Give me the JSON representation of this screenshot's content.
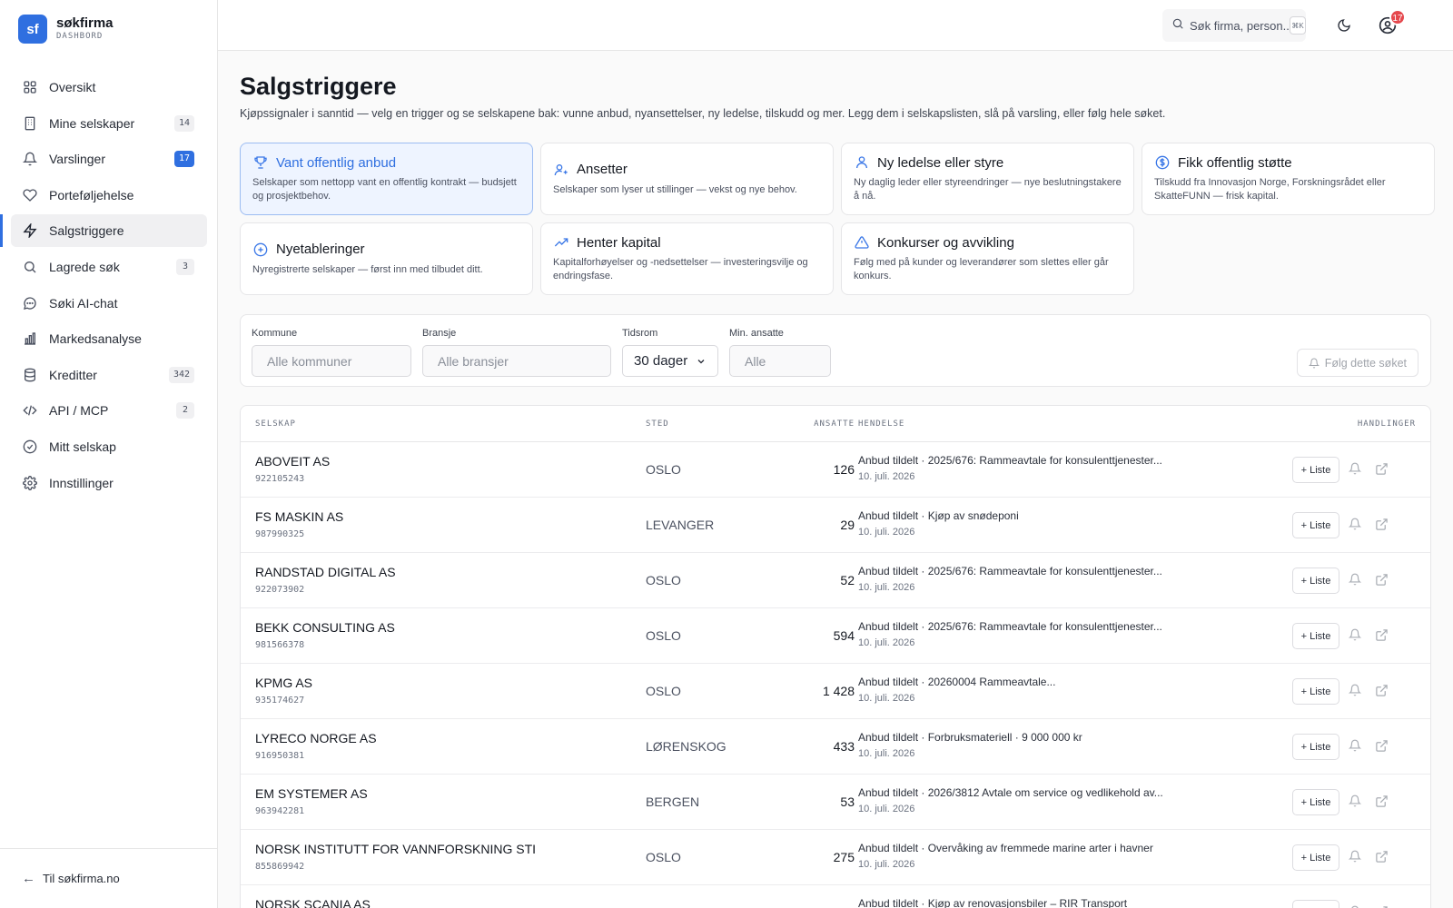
{
  "brand": {
    "logo": "sf",
    "name": "søkfirma",
    "subtitle": "DASHBORD"
  },
  "nav": [
    {
      "label": "Oversikt",
      "icon": "grid-icon",
      "badge": ""
    },
    {
      "label": "Mine selskaper",
      "icon": "building-icon",
      "badge": "14"
    },
    {
      "label": "Varslinger",
      "icon": "bell-icon",
      "badge": "17",
      "badge_style": "blue"
    },
    {
      "label": "Porteføljehelse",
      "icon": "heart-icon",
      "badge": ""
    },
    {
      "label": "Salgstriggere",
      "icon": "bolt-icon",
      "badge": "",
      "active": true
    },
    {
      "label": "Lagrede søk",
      "icon": "search-icon",
      "badge": "3"
    },
    {
      "label": "Søki AI-chat",
      "icon": "chat-icon",
      "badge": ""
    },
    {
      "label": "Markedsanalyse",
      "icon": "bar-chart-icon",
      "badge": ""
    },
    {
      "label": "Kreditter",
      "icon": "database-icon",
      "badge": "342"
    },
    {
      "label": "API / MCP",
      "icon": "code-icon",
      "badge": "2"
    },
    {
      "label": "Mitt selskap",
      "icon": "check-circle-icon",
      "badge": ""
    },
    {
      "label": "Innstillinger",
      "icon": "gear-icon",
      "badge": ""
    }
  ],
  "footer_link": "Til søkfirma.no",
  "topbar": {
    "search_placeholder": "Søk firma, person...",
    "shortcut": "⌘K",
    "notification_count": "17"
  },
  "page": {
    "title": "Salgstriggere",
    "subtitle": "Kjøpssignaler i sanntid — velg en trigger og se selskapene bak: vunne anbud, nyansettelser, ny ledelse, tilskudd og mer. Legg dem i selskapslisten, slå på varsling, eller følg hele søket."
  },
  "triggers": [
    {
      "title": "Vant offentlig anbud",
      "desc": "Selskaper som nettopp vant en offentlig kontrakt — budsjett og prosjektbehov.",
      "icon": "trophy-icon",
      "active": true
    },
    {
      "title": "Ansetter",
      "desc": "Selskaper som lyser ut stillinger — vekst og nye behov.",
      "icon": "user-plus-icon"
    },
    {
      "title": "Ny ledelse eller styre",
      "desc": "Ny daglig leder eller styreendringer — nye beslutningstakere å nå.",
      "icon": "user-icon"
    },
    {
      "title": "Fikk offentlig støtte",
      "desc": "Tilskudd fra Innovasjon Norge, Forskningsrådet eller SkatteFUNN — frisk kapital.",
      "icon": "dollar-circle-icon"
    },
    {
      "title": "Nyetableringer",
      "desc": "Nyregistrerte selskaper — først inn med tilbudet ditt.",
      "icon": "plus-circle-icon"
    },
    {
      "title": "Henter kapital",
      "desc": "Kapitalforhøyelser og -nedsettelser — investeringsvilje og endringsfase.",
      "icon": "trend-up-icon"
    },
    {
      "title": "Konkurser og avvikling",
      "desc": "Følg med på kunder og leverandører som slettes eller går konkurs.",
      "icon": "warning-icon"
    }
  ],
  "filters": {
    "kommune": {
      "label": "Kommune",
      "placeholder": "Alle kommuner"
    },
    "bransje": {
      "label": "Bransje",
      "placeholder": "Alle bransjer"
    },
    "tidsrom": {
      "label": "Tidsrom",
      "value": "30 dager"
    },
    "ansatte": {
      "label": "Min. ansatte",
      "placeholder": "Alle"
    },
    "follow_label": "Følg dette søket"
  },
  "table": {
    "headers": {
      "company": "SELSKAP",
      "place": "STED",
      "employees": "ANSATTE",
      "event": "HENDELSE",
      "actions": "HANDLINGER"
    },
    "add_label": "+ Liste",
    "rows": [
      {
        "name": "ABOVEIT AS",
        "org": "922105243",
        "place": "OSLO",
        "employees": "126",
        "event": "Anbud tildelt · 2025/676: Rammeavtale for konsulenttjenester...",
        "date": "10. juli. 2026"
      },
      {
        "name": "FS MASKIN AS",
        "org": "987990325",
        "place": "LEVANGER",
        "employees": "29",
        "event": "Anbud tildelt · Kjøp av snødeponi",
        "date": "10. juli. 2026"
      },
      {
        "name": "RANDSTAD DIGITAL AS",
        "org": "922073902",
        "place": "OSLO",
        "employees": "52",
        "event": "Anbud tildelt · 2025/676: Rammeavtale for konsulenttjenester...",
        "date": "10. juli. 2026"
      },
      {
        "name": "BEKK CONSULTING AS",
        "org": "981566378",
        "place": "OSLO",
        "employees": "594",
        "event": "Anbud tildelt · 2025/676: Rammeavtale for konsulenttjenester...",
        "date": "10. juli. 2026"
      },
      {
        "name": "KPMG AS",
        "org": "935174627",
        "place": "OSLO",
        "employees": "1 428",
        "event": "Anbud tildelt · 20260004 Rammeavtale...",
        "date": "10. juli. 2026"
      },
      {
        "name": "LYRECO NORGE AS",
        "org": "916950381",
        "place": "LØRENSKOG",
        "employees": "433",
        "event": "Anbud tildelt · Forbruksmateriell · 9 000 000 kr",
        "date": "10. juli. 2026"
      },
      {
        "name": "EM SYSTEMER AS",
        "org": "963942281",
        "place": "BERGEN",
        "employees": "53",
        "event": "Anbud tildelt · 2026/3812 Avtale om service og vedlikehold av...",
        "date": "10. juli. 2026"
      },
      {
        "name": "NORSK INSTITUTT FOR VANNFORSKNING STI",
        "org": "855869942",
        "place": "OSLO",
        "employees": "275",
        "event": "Anbud tildelt · Overvåking av fremmede marine arter i havner",
        "date": "10. juli. 2026"
      },
      {
        "name": "NORSK SCANIA AS",
        "org": "",
        "place": "",
        "employees": "",
        "event": "Anbud tildelt · Kjøp av renovasjonsbiler – RIR Transport",
        "date": ""
      }
    ]
  }
}
